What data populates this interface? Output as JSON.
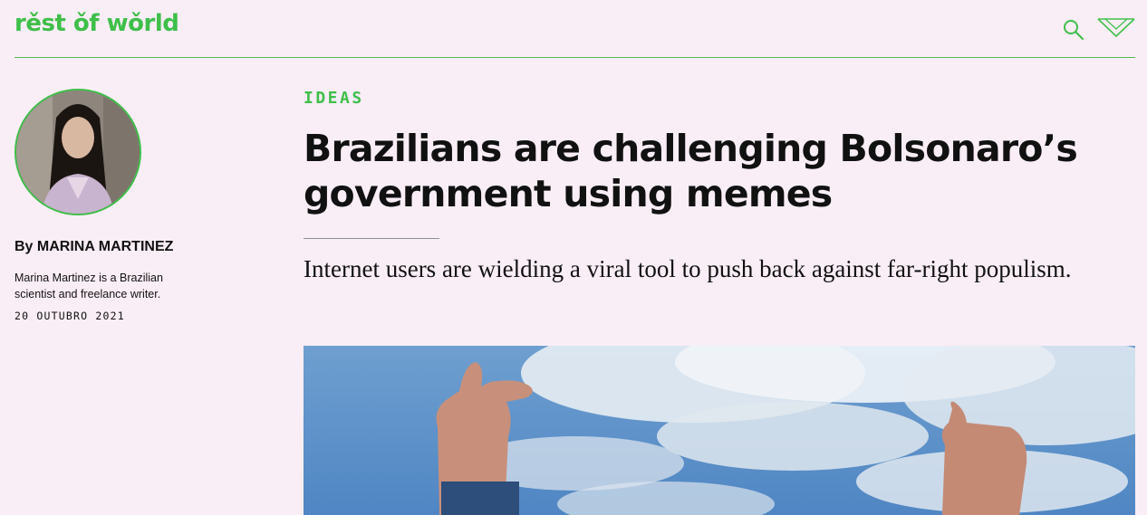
{
  "site": {
    "logo": "rěst ǒf wǒrld",
    "brand_color": "#3fbf4a",
    "header_icons": [
      "search-icon",
      "menu-chevron-icon"
    ]
  },
  "author": {
    "byline": "By MARINA MARTINEZ",
    "bio": "Marina Martinez is a Brazilian scientist and freelance writer.",
    "date": "20 OUTUBRO 2021"
  },
  "article": {
    "category": "IDEAS",
    "headline": "Brazilians are challenging Bolsonaro’s government using memes",
    "dek": "Internet users are wielding a viral tool to push back against far-right populism."
  },
  "hero_image": {
    "subject": "hands-thumbs-up-sky"
  }
}
